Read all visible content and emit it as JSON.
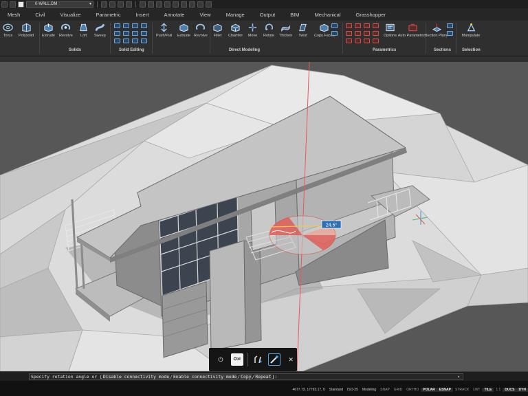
{
  "quick_access": {
    "layer_name": "0-WALL.DM",
    "buttons": [
      "new-file-icon",
      "open-icon",
      "save-icon",
      "layer-state-icon"
    ]
  },
  "tabs": [
    {
      "label": "Mesh"
    },
    {
      "label": "Civil"
    },
    {
      "label": "Visualize"
    },
    {
      "label": "Parametric"
    },
    {
      "label": "Insert"
    },
    {
      "label": "Annotate"
    },
    {
      "label": "View"
    },
    {
      "label": "Manage"
    },
    {
      "label": "Output"
    },
    {
      "label": "BIM"
    },
    {
      "label": "Mechanical"
    },
    {
      "label": "Grasshopper"
    }
  ],
  "ribbon": {
    "solids": {
      "title": "Solids",
      "tools": [
        {
          "label": "Torus",
          "icon": "torus-icon"
        },
        {
          "label": "Polysolid",
          "icon": "polysolid-icon"
        },
        {
          "label": "Extrude",
          "icon": "extrude-icon"
        },
        {
          "label": "Revolve",
          "icon": "revolve-icon"
        },
        {
          "label": "Loft",
          "icon": "loft-icon"
        },
        {
          "label": "Sweep",
          "icon": "sweep-icon"
        }
      ]
    },
    "solid_editing": {
      "title": "Solid Editing"
    },
    "direct_modeling": {
      "title": "Direct Modeling",
      "tools": [
        {
          "label": "Push/Pull",
          "icon": "push-pull-icon"
        },
        {
          "label": "Extrude",
          "icon": "extrude-icon"
        },
        {
          "label": "Revolve",
          "icon": "revolve-icon"
        },
        {
          "label": "Fillet",
          "icon": "fillet-icon"
        },
        {
          "label": "Chamfer",
          "icon": "chamfer-icon"
        },
        {
          "label": "Move",
          "icon": "move-icon"
        },
        {
          "label": "Rotate",
          "icon": "rotate-icon"
        },
        {
          "label": "Thicken",
          "icon": "thicken-icon"
        },
        {
          "label": "Twist",
          "icon": "twist-icon"
        },
        {
          "label": "Copy Faces",
          "icon": "copy-faces-icon"
        }
      ]
    },
    "parametrics": {
      "title": "Parametrics",
      "tools": [
        {
          "label": "Options",
          "icon": "options-icon"
        },
        {
          "label": "Auto Parametrize",
          "icon": "auto-parametrize-icon"
        }
      ]
    },
    "sections": {
      "title": "Sections",
      "tools": [
        {
          "label": "Section Plane",
          "icon": "section-plane-icon"
        }
      ]
    },
    "selection": {
      "title": "Selection",
      "tools": [
        {
          "label": "Manipulate",
          "icon": "manipulate-icon"
        }
      ]
    }
  },
  "viewport": {
    "rotation_angle_tooltip": "24.5°",
    "accent_red": "#e3504a",
    "axis_color": "#e85a55"
  },
  "floating_toolbar": {
    "ctrl_label": "Ctrl",
    "buttons": [
      "power-icon",
      "ctrl-key",
      "connectivity-icon",
      "direct-edit-icon",
      "close-icon"
    ]
  },
  "command_line": {
    "prefix": "Specify rotation angle or [",
    "option1": "Disable connectivity mode",
    "option2": "Enable connectivity mode",
    "option3": "Copy",
    "option4": "Repeat",
    "suffix": "]:"
  },
  "status_bar": {
    "coordinates": "4677.73, 17793.17, 0",
    "style": "Standard",
    "dim_style": "ISO-25",
    "workspace": "Modeling",
    "toggles": [
      {
        "label": "SNAP",
        "on": false
      },
      {
        "label": "GRID",
        "on": false
      },
      {
        "label": "ORTHO",
        "on": false
      },
      {
        "label": "POLAR",
        "on": true
      },
      {
        "label": "ESNAP",
        "on": true
      },
      {
        "label": "STRACK",
        "on": false
      },
      {
        "label": "LWT",
        "on": false
      },
      {
        "label": "TILE",
        "on": true
      },
      {
        "label": "1:1",
        "on": false
      },
      {
        "label": "DUCS",
        "on": true
      },
      {
        "label": "DYN",
        "on": true
      }
    ]
  }
}
